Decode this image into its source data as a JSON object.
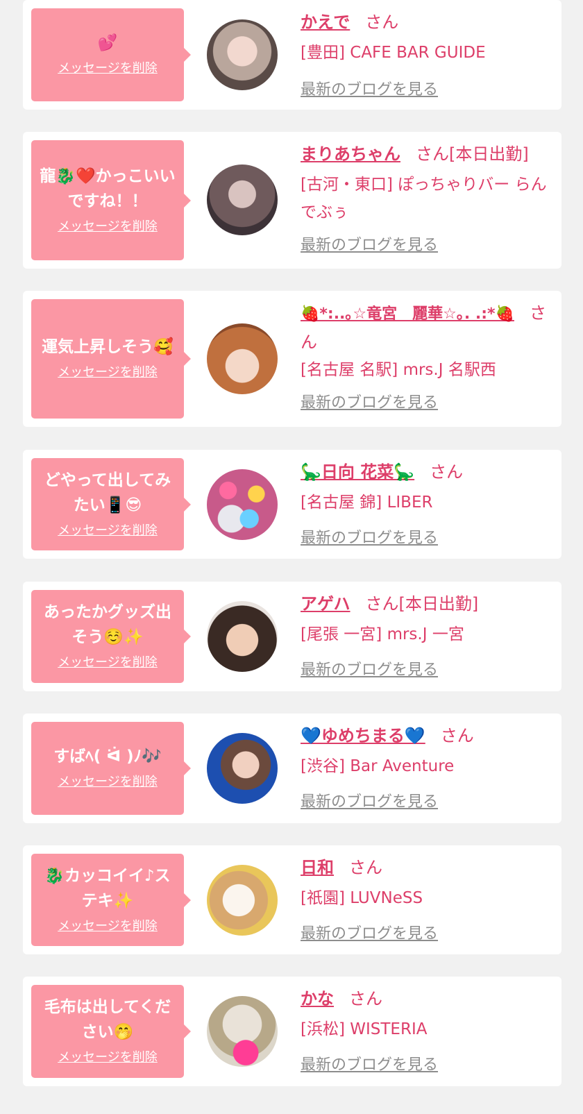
{
  "delete_label": "メッセージを削除",
  "honorific": "さん",
  "blog_label": "最新のブログを見る",
  "items": [
    {
      "message": "💕",
      "name": "かえで",
      "status": "",
      "shop": "[豊田] CAFE BAR GUIDE"
    },
    {
      "message": "龍🐉❤️かっこいいですね！！",
      "name": "まりあちゃん",
      "status": "[本日出勤]",
      "shop": "[古河・東口] ぽっちゃりバー らんでぶぅ"
    },
    {
      "message": "運気上昇しそう🥰",
      "name": "🍓*:..｡☆竜宮　麗華☆｡. .:*🍓",
      "status": "",
      "shop": "[名古屋 名駅] mrs.J 名駅西"
    },
    {
      "message": "どやって出してみたい📱😎",
      "name": "🦕日向 花菜🦕",
      "status": "",
      "shop": "[名古屋 錦] LIBER"
    },
    {
      "message": "あったかグッズ出そう☺️✨",
      "name": "アゲハ",
      "status": "[本日出勤]",
      "shop": "[尾張 一宮] mrs.J 一宮"
    },
    {
      "message": "すばﾍ( ᐛ )ﾉ🎶",
      "name": "💙ゆめちまる💙",
      "status": "",
      "shop": "[渋谷] Bar Aventure"
    },
    {
      "message": "🐉カッコイイ♪ステキ✨",
      "name": "日和",
      "status": "",
      "shop": "[祇園] LUVNeSS"
    },
    {
      "message": "毛布は出してください🤭",
      "name": "かな",
      "status": "",
      "shop": "[浜松] WISTERIA"
    }
  ],
  "colors": {
    "accent": "#dd3e69",
    "bubble": "#fb97a4",
    "card": "#ffffff",
    "background": "#f1f1f1",
    "link_gray": "#8d8d8d"
  }
}
